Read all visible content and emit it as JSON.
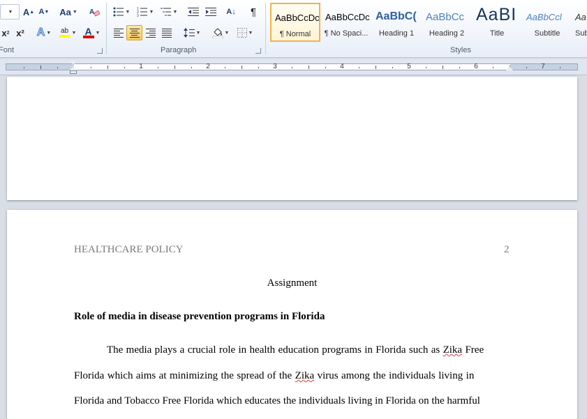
{
  "ribbon": {
    "groups": {
      "font": "Font",
      "paragraph": "Paragraph",
      "styles": "Styles"
    },
    "font_buttons": {
      "grow": "A",
      "shrink": "A",
      "change_case": "Aa",
      "subscript": "x",
      "superscript": "x²",
      "text_effects": "A",
      "highlight": "ab",
      "font_color": "A"
    },
    "paragraph_buttons": {
      "sort": "A↓",
      "show_marks": "¶"
    },
    "styles": [
      {
        "sample": "AaBbCcDc",
        "name": "¶ Normal",
        "color": "#000000"
      },
      {
        "sample": "AaBbCcDc",
        "name": "¶ No Spaci...",
        "color": "#000000"
      },
      {
        "sample": "AaBbC(",
        "name": "Heading 1",
        "color": "#2f5fa0"
      },
      {
        "sample": "AaBbCc",
        "name": "Heading 2",
        "color": "#4f81bd"
      },
      {
        "sample": "AaBI",
        "name": "Title",
        "color": "#17365d"
      },
      {
        "sample": "AaBbCcl",
        "name": "Subtitle",
        "color": "#4f81bd"
      },
      {
        "sample": "Aa",
        "name": "Sub",
        "color": "#333333"
      }
    ]
  },
  "ruler": {
    "numbers": [
      "1",
      "2",
      "3",
      "4",
      "5",
      "6",
      "7"
    ]
  },
  "document": {
    "header_left": "HEALTHCARE POLICY",
    "header_right": "2",
    "title": "Assignment",
    "heading": "Role of media in disease prevention programs in Florida",
    "para_line1_a": "The media plays a crucial role in health education programs in Florida such as ",
    "zika1": "Zika",
    "para_line1_b": " Free",
    "para_line2_a": "Florida which aims at minimizing the spread of the ",
    "zika2": "Zika",
    "para_line2_b": " virus among the individuals living in",
    "para_line3": "Florida and Tobacco Free Florida which educates the individuals living in Florida on the harmful"
  },
  "colors": {
    "highlight": "#ffff00",
    "font_color_bar": "#e00000",
    "ribbon_accent": "#1e3f73"
  }
}
